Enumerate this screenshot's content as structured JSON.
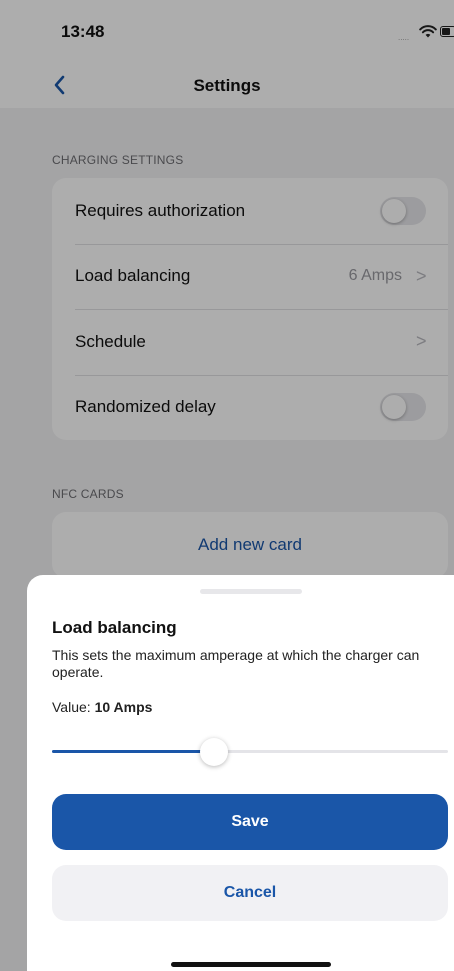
{
  "status_bar": {
    "time": "13:48",
    "signal": ".....",
    "icons": [
      "signal-dots-icon",
      "wifi-icon",
      "battery-icon"
    ]
  },
  "nav": {
    "title": "Settings",
    "back_icon": "chevron-left-icon"
  },
  "charging_settings": {
    "header": "CHARGING SETTINGS",
    "rows": [
      {
        "label": "Requires authorization",
        "type": "toggle",
        "on": false
      },
      {
        "label": "Load balancing",
        "type": "value",
        "value": "6 Amps",
        "chevron": ">"
      },
      {
        "label": "Schedule",
        "type": "chevron",
        "chevron": ">"
      },
      {
        "label": "Randomized delay",
        "type": "toggle",
        "on": false
      }
    ]
  },
  "nfc_cards": {
    "header": "NFC CARDS",
    "add_label": "Add new card"
  },
  "sheet": {
    "title": "Load balancing",
    "description": "This sets the maximum amperage at which the charger can operate.",
    "value_prefix": "Value:",
    "value": "10 Amps",
    "slider_fraction": 0.41,
    "save_label": "Save",
    "cancel_label": "Cancel"
  },
  "colors": {
    "accent": "#1a56a8",
    "toggle_off": "#e6e6ea",
    "grouped_background": "#f2f2f4"
  }
}
